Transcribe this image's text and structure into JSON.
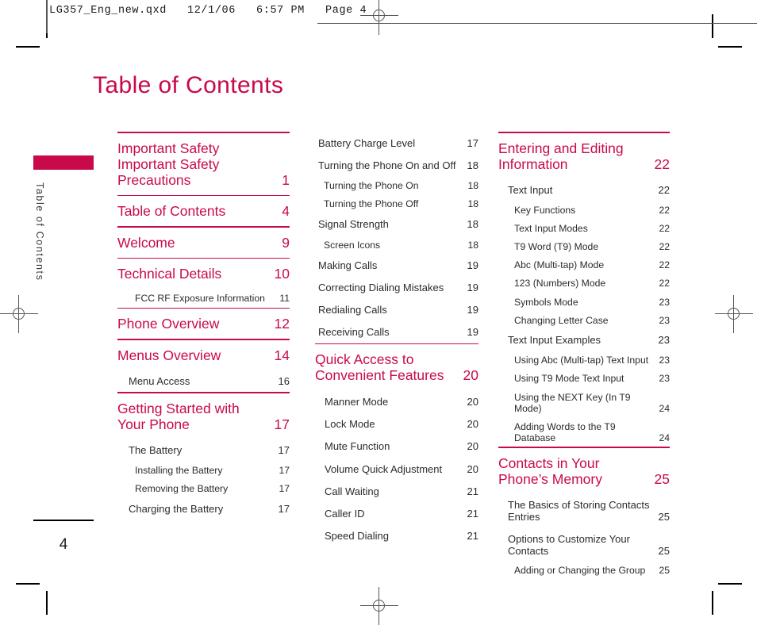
{
  "slug": {
    "text": "LG357_Eng_new.qxd   12/1/06   6:57 PM   Page 4"
  },
  "colors": {
    "accent": "#c90a4a",
    "body_text": "#2b2b2b",
    "mark": "#555555"
  },
  "side_tab": {
    "label": "Table of Contents"
  },
  "folio": {
    "page_number": "4"
  },
  "title": "Table of Contents",
  "columns": {
    "col1": [
      {
        "kind": "rule"
      },
      {
        "kind": "entry",
        "level": 0,
        "label": "Important Safety Important Safety Precautions",
        "page": "1"
      },
      {
        "kind": "rule"
      },
      {
        "kind": "entry",
        "level": 0,
        "label": "Table of Contents",
        "page": "4"
      },
      {
        "kind": "rule"
      },
      {
        "kind": "entry",
        "level": 0,
        "label": "Welcome",
        "page": "9"
      },
      {
        "kind": "rule"
      },
      {
        "kind": "entry",
        "level": 0,
        "label": "Technical Details",
        "page": "10"
      },
      {
        "kind": "entry",
        "level": 2,
        "label": "FCC RF Exposure Information",
        "page": "11"
      },
      {
        "kind": "rule"
      },
      {
        "kind": "entry",
        "level": 0,
        "label": "Phone Overview",
        "page": "12"
      },
      {
        "kind": "rule"
      },
      {
        "kind": "entry",
        "level": 0,
        "label": "Menus Overview",
        "page": "14"
      },
      {
        "kind": "entry",
        "level": 1,
        "label": "Menu Access",
        "page": "16"
      },
      {
        "kind": "rule"
      },
      {
        "kind": "entry",
        "level": 0,
        "label": "Getting Started with Your Phone",
        "page": "17"
      },
      {
        "kind": "entry",
        "level": 1,
        "label": "The Battery",
        "page": "17"
      },
      {
        "kind": "entry",
        "level": 2,
        "label": "Installing the Battery",
        "page": "17"
      },
      {
        "kind": "entry",
        "level": 2,
        "label": "Removing the Battery",
        "page": "17"
      },
      {
        "kind": "entry",
        "level": 1,
        "label": "Charging the Battery",
        "page": "17"
      }
    ],
    "col2_top": [
      {
        "kind": "entry",
        "level": 1,
        "label": "Battery Charge Level",
        "page": "17"
      },
      {
        "kind": "entry",
        "level": 1,
        "label": "Turning the Phone On and Off",
        "page": "18"
      },
      {
        "kind": "entry",
        "level": 2,
        "label": "Turning the Phone On",
        "page": "18"
      },
      {
        "kind": "entry",
        "level": 2,
        "label": "Turning the Phone Off",
        "page": "18"
      },
      {
        "kind": "entry",
        "level": 1,
        "label": "Signal Strength",
        "page": "18"
      },
      {
        "kind": "entry",
        "level": 2,
        "label": "Screen Icons",
        "page": "18"
      },
      {
        "kind": "entry",
        "level": 1,
        "label": "Making Calls",
        "page": "19"
      },
      {
        "kind": "entry",
        "level": 1,
        "label": "Correcting Dialing Mistakes",
        "page": "19"
      },
      {
        "kind": "entry",
        "level": 1,
        "label": "Redialing Calls",
        "page": "19"
      },
      {
        "kind": "entry",
        "level": 1,
        "label": "Receiving Calls",
        "page": "19"
      }
    ],
    "col2_quick_access": [
      {
        "kind": "rule"
      },
      {
        "kind": "entry",
        "level": 0,
        "label": "Quick Access to Convenient Features",
        "page": "20"
      },
      {
        "kind": "entry",
        "level": 1,
        "label": "Manner Mode",
        "page": "20"
      },
      {
        "kind": "entry",
        "level": 1,
        "label": "Lock Mode",
        "page": "20"
      },
      {
        "kind": "entry",
        "level": 1,
        "label": "Mute Function",
        "page": "20"
      },
      {
        "kind": "entry",
        "level": 1,
        "label": "Volume Quick Adjustment",
        "page": "20"
      },
      {
        "kind": "entry",
        "level": 1,
        "label": "Call Waiting",
        "page": "21"
      },
      {
        "kind": "entry",
        "level": 1,
        "label": "Caller ID",
        "page": "21"
      },
      {
        "kind": "entry",
        "level": 1,
        "label": "Speed Dialing",
        "page": "21"
      }
    ],
    "col3": [
      {
        "kind": "rule"
      },
      {
        "kind": "entry",
        "level": 0,
        "label": "Entering and Editing Information",
        "page": "22"
      },
      {
        "kind": "entry",
        "level": 1,
        "label": "Text Input",
        "page": "22"
      },
      {
        "kind": "entry",
        "level": 2,
        "label": "Key Functions",
        "page": "22"
      },
      {
        "kind": "entry",
        "level": 2,
        "label": "Text Input Modes",
        "page": "22"
      },
      {
        "kind": "entry",
        "level": 2,
        "label": "T9 Word (T9) Mode",
        "page": "22"
      },
      {
        "kind": "entry",
        "level": 2,
        "label": "Abc (Multi-tap) Mode",
        "page": "22"
      },
      {
        "kind": "entry",
        "level": 2,
        "label": "123 (Numbers) Mode",
        "page": "22"
      },
      {
        "kind": "entry",
        "level": 2,
        "label": "Symbols Mode",
        "page": "23"
      },
      {
        "kind": "entry",
        "level": 2,
        "label": "Changing Letter Case",
        "page": "23"
      },
      {
        "kind": "entry",
        "level": 1,
        "label": "Text Input Examples",
        "page": "23"
      },
      {
        "kind": "entry",
        "level": 2,
        "label": "Using Abc (Multi-tap) Text Input",
        "page": "23"
      },
      {
        "kind": "entry",
        "level": 2,
        "label": "Using T9 Mode Text Input",
        "page": "23"
      },
      {
        "kind": "entry",
        "level": 2,
        "label": "Using the NEXT Key (In T9 Mode)",
        "page": "24"
      },
      {
        "kind": "entry",
        "level": 2,
        "label": "Adding Words to the T9 Database",
        "page": "24"
      },
      {
        "kind": "rule"
      },
      {
        "kind": "entry",
        "level": 0,
        "label": "Contacts in Your Phone’s Memory",
        "page": "25"
      },
      {
        "kind": "entry",
        "level": 1,
        "label": "The Basics of Storing Contacts Entries",
        "page": "25"
      },
      {
        "kind": "entry",
        "level": 1,
        "label": "Options to Customize Your Contacts",
        "page": "25"
      },
      {
        "kind": "entry",
        "level": 2,
        "label": "Adding or Changing the Group",
        "page": "25"
      }
    ]
  }
}
